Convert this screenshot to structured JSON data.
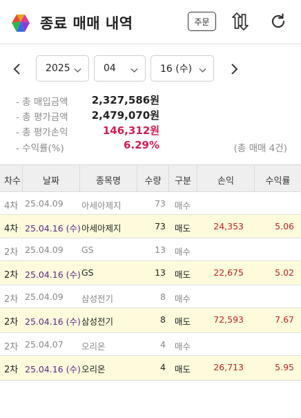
{
  "header": {
    "title": "종료 매매 내역",
    "order_label": "주문"
  },
  "date_picker": {
    "year": "2025",
    "month": "04",
    "day": "16 (수)"
  },
  "summary": {
    "items": [
      {
        "label": "- 총 매입금액",
        "value": "2,327,586원"
      },
      {
        "label": "- 총 평가금액",
        "value": "2,479,070원"
      },
      {
        "label": "- 총 평가손익",
        "value": "146,312원"
      },
      {
        "label": "- 수익률(%)",
        "value": "6.29%"
      }
    ],
    "trade_count": "(총 매매 4건)"
  },
  "table": {
    "headers": [
      "차수",
      "날짜",
      "종목명",
      "수량",
      "구분",
      "손익",
      "수익률"
    ],
    "rows": [
      {
        "rank": "4차",
        "date": "25.04.09",
        "name": "아세아제지",
        "qty": "73",
        "type": "매수",
        "profit": "",
        "rate": "",
        "sell": false
      },
      {
        "rank": "4차",
        "date": "25.04.16 (수)",
        "name": "아세아제지",
        "qty": "73",
        "type": "매도",
        "profit": "24,353",
        "rate": "5.06",
        "sell": true
      },
      {
        "rank": "2차",
        "date": "25.04.09",
        "name": "GS",
        "qty": "13",
        "type": "매수",
        "profit": "",
        "rate": "",
        "sell": false
      },
      {
        "rank": "2차",
        "date": "25.04.16 (수)",
        "name": "GS",
        "qty": "13",
        "type": "매도",
        "profit": "22,675",
        "rate": "5.02",
        "sell": true
      },
      {
        "rank": "2차",
        "date": "25.04.09",
        "name": "삼성전기",
        "qty": "8",
        "type": "매수",
        "profit": "",
        "rate": "",
        "sell": false
      },
      {
        "rank": "2차",
        "date": "25.04.16 (수)",
        "name": "삼성전기",
        "qty": "8",
        "type": "매도",
        "profit": "72,593",
        "rate": "7.67",
        "sell": true
      },
      {
        "rank": "2차",
        "date": "25.04.07",
        "name": "오리온",
        "qty": "4",
        "type": "매수",
        "profit": "",
        "rate": "",
        "sell": false
      },
      {
        "rank": "2차",
        "date": "25.04.16 (수)",
        "name": "오리온",
        "qty": "4",
        "type": "매도",
        "profit": "26,713",
        "rate": "5.95",
        "sell": true
      }
    ]
  },
  "colors": {
    "accent_red": "#d31b4f",
    "sell_row_bg": "#fdfbdc",
    "sell_date": "#5b2a86",
    "profit": "#c32121"
  }
}
